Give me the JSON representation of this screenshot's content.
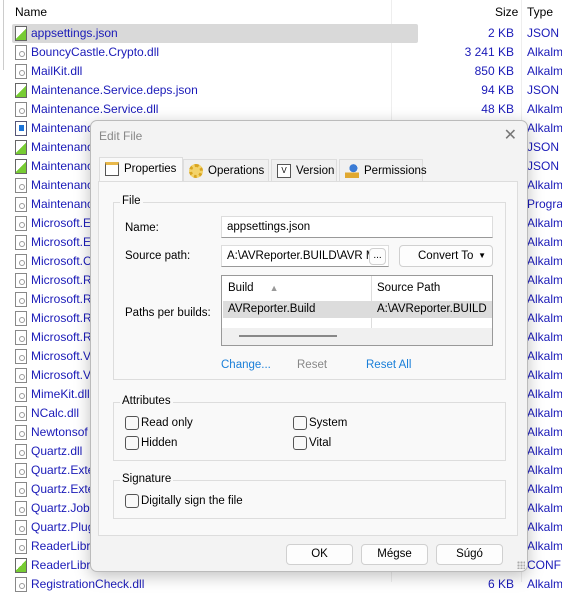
{
  "list": {
    "headers": {
      "name": "Name",
      "size": "Size",
      "type": "Type"
    },
    "rows": [
      {
        "name": "appsettings.json",
        "size": "2 KB",
        "type": "JSON f",
        "icon": "json",
        "selected": true
      },
      {
        "name": "BouncyCastle.Crypto.dll",
        "size": "3 241 KB",
        "type": "Alkalm",
        "icon": "dll"
      },
      {
        "name": "MailKit.dll",
        "size": "850 KB",
        "type": "Alkalm",
        "icon": "dll"
      },
      {
        "name": "Maintenance.Service.deps.json",
        "size": "94 KB",
        "type": "JSON f",
        "icon": "json"
      },
      {
        "name": "Maintenance.Service.dll",
        "size": "48 KB",
        "type": "Alkalm",
        "icon": "dll"
      },
      {
        "name": "Maintenanc",
        "size": "",
        "type": "Alkalm",
        "icon": "exe"
      },
      {
        "name": "Maintenanc",
        "size": "",
        "type": "JSON f",
        "icon": "json"
      },
      {
        "name": "Maintenanc",
        "size": "",
        "type": "JSON f",
        "icon": "json"
      },
      {
        "name": "Maintenanc",
        "size": "",
        "type": "Alkalm",
        "icon": "dll"
      },
      {
        "name": "Maintenanc",
        "size": "",
        "type": "Progra",
        "icon": "dll"
      },
      {
        "name": "Microsoft.E",
        "size": "",
        "type": "Alkalm",
        "icon": "dll"
      },
      {
        "name": "Microsoft.E",
        "size": "",
        "type": "Alkalm",
        "icon": "dll"
      },
      {
        "name": "Microsoft.C",
        "size": "",
        "type": "Alkalm",
        "icon": "dll"
      },
      {
        "name": "Microsoft.R",
        "size": "",
        "type": "Alkalm",
        "icon": "dll"
      },
      {
        "name": "Microsoft.R",
        "size": "",
        "type": "Alkalm",
        "icon": "dll"
      },
      {
        "name": "Microsoft.R",
        "size": "",
        "type": "Alkalm",
        "icon": "dll"
      },
      {
        "name": "Microsoft.R",
        "size": "",
        "type": "Alkalm",
        "icon": "dll"
      },
      {
        "name": "Microsoft.V",
        "size": "",
        "type": "Alkalm",
        "icon": "dll"
      },
      {
        "name": "Microsoft.V",
        "size": "",
        "type": "Alkalm",
        "icon": "dll"
      },
      {
        "name": "MimeKit.dll",
        "size": "",
        "type": "Alkalm",
        "icon": "dll"
      },
      {
        "name": "NCalc.dll",
        "size": "",
        "type": "Alkalm",
        "icon": "dll"
      },
      {
        "name": "Newtonsof",
        "size": "",
        "type": "Alkalm",
        "icon": "dll"
      },
      {
        "name": "Quartz.dll",
        "size": "",
        "type": "Alkalm",
        "icon": "dll"
      },
      {
        "name": "Quartz.Exte",
        "size": "",
        "type": "Alkalm",
        "icon": "dll"
      },
      {
        "name": "Quartz.Exte",
        "size": "",
        "type": "Alkalm",
        "icon": "dll"
      },
      {
        "name": "Quartz.Jobs",
        "size": "",
        "type": "Alkalm",
        "icon": "dll"
      },
      {
        "name": "Quartz.Plug",
        "size": "",
        "type": "Alkalm",
        "icon": "dll"
      },
      {
        "name": "ReaderLibra",
        "size": "",
        "type": "Alkalm",
        "icon": "dll"
      },
      {
        "name": "ReaderLibra",
        "size": "",
        "type": "CONFI",
        "icon": "json"
      },
      {
        "name": "RegistrationCheck.dll",
        "size": "6 KB",
        "type": "Alkalm",
        "icon": "dll"
      }
    ]
  },
  "dialog": {
    "title": "Edit File",
    "tabs": [
      {
        "label": "Properties",
        "icon": "properties-icon"
      },
      {
        "label": "Operations",
        "icon": "gear-icon"
      },
      {
        "label": "Version",
        "icon": "version-icon"
      },
      {
        "label": "Permissions",
        "icon": "key-user-icon"
      }
    ],
    "file_group": "File",
    "name_label": "Name:",
    "name_value": "appsettings.json",
    "source_label": "Source path:",
    "source_value": "A:\\AVReporter.BUILD\\AVR Ma",
    "browse": "...",
    "convert": "Convert To",
    "paths_label": "Paths per builds:",
    "grid": {
      "headers": [
        "Build",
        "Source Path"
      ],
      "rows": [
        [
          "AVReporter.Build",
          "A:\\AVReporter.BUILD"
        ]
      ]
    },
    "links": {
      "change": "Change...",
      "reset": "Reset",
      "reset_all": "Reset All"
    },
    "attributes_group": "Attributes",
    "attributes": {
      "read_only": "Read only",
      "system": "System",
      "hidden": "Hidden",
      "vital": "Vital"
    },
    "signature_group": "Signature",
    "sign": "Digitally sign the file",
    "buttons": {
      "ok": "OK",
      "cancel": "Mégse",
      "help": "Súgó"
    }
  }
}
